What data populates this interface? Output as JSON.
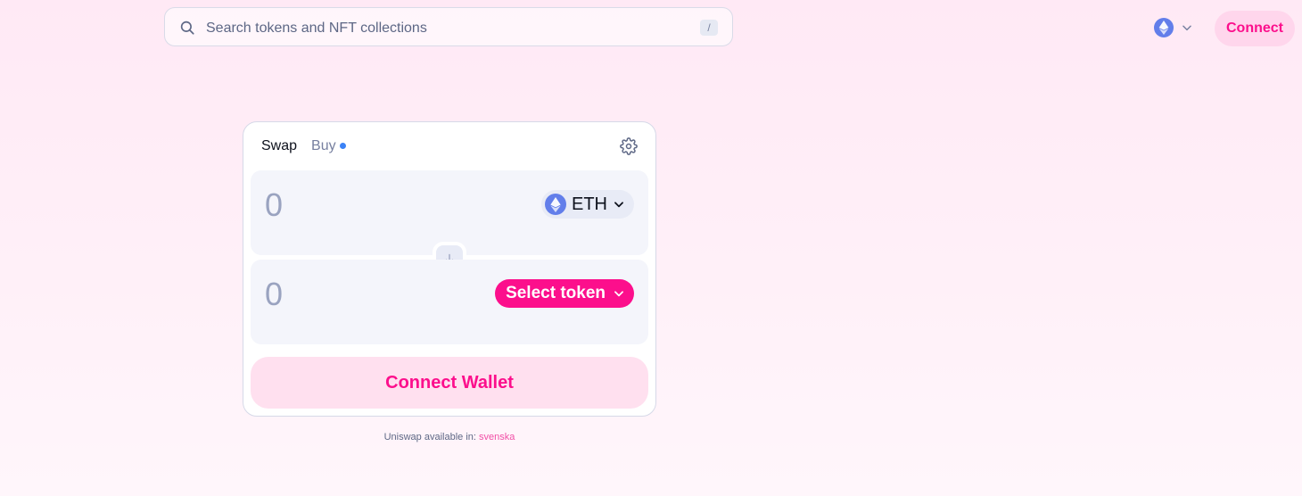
{
  "search": {
    "placeholder": "Search tokens and NFT collections",
    "shortcut": "/"
  },
  "header": {
    "network_icon": "ethereum-icon",
    "connect_label": "Connect"
  },
  "swap": {
    "tabs": [
      {
        "label": "Swap"
      },
      {
        "label": "Buy"
      }
    ],
    "input": {
      "amount": "0",
      "token": "ETH"
    },
    "output": {
      "amount": "0",
      "select_label": "Select token"
    },
    "connect_wallet_label": "Connect Wallet"
  },
  "footer": {
    "text": "Uniswap available in:",
    "language": "svenska"
  },
  "colors": {
    "accent": "#fc0f8c",
    "eth": "#627eea",
    "buy_dot": "#3b82f6"
  }
}
